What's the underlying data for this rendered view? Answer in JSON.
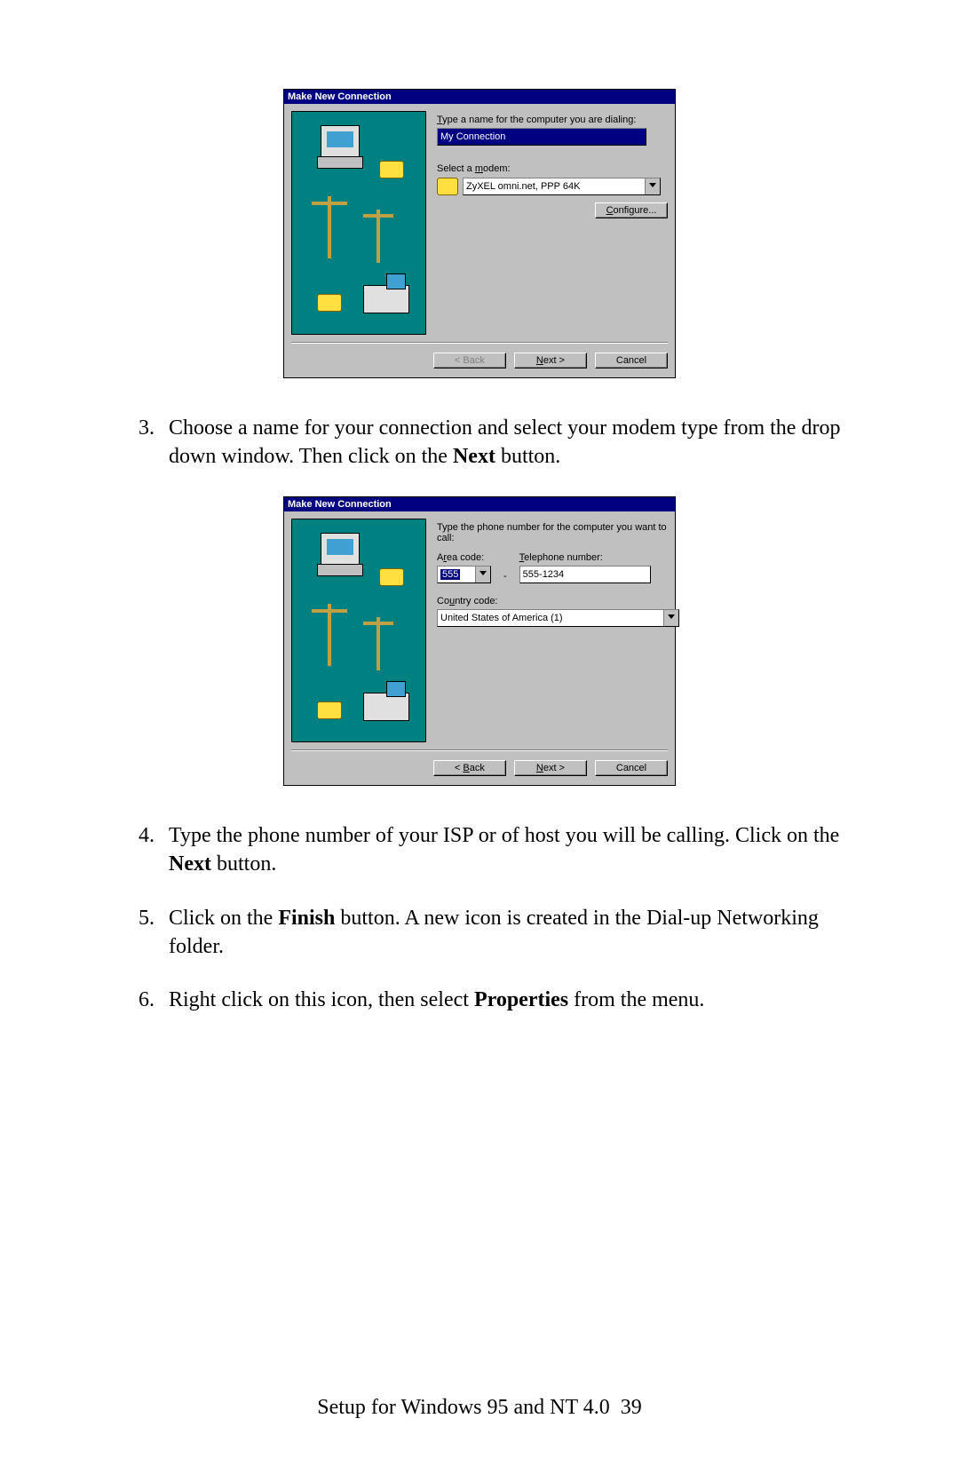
{
  "dialog1": {
    "title": "Make New Connection",
    "label1": "Type a name for the computer you are dialing:",
    "input_value": "My Connection",
    "label2": "Select a modem:",
    "modem_value": "ZyXEL omni.net, PPP  64K",
    "configure_btn": "Configure...",
    "back_btn": "< Back",
    "next_btn": "Next >",
    "cancel_btn": "Cancel"
  },
  "dialog2": {
    "title": "Make New Connection",
    "label1": "Type the phone number for the computer you want to call:",
    "area_label": "Area code:",
    "area_value": "555",
    "tel_label": "Telephone number:",
    "tel_value": "555-1234",
    "country_label": "Country code:",
    "country_value": "United States of America (1)",
    "back_btn": "< Back",
    "next_btn": "Next >",
    "cancel_btn": "Cancel"
  },
  "steps": {
    "s3a": "Choose a name for your connection and select your modem type from the drop down window. Then click on the ",
    "s3b": "Next",
    "s3c": " button.",
    "s4a": "Type the phone number of your ISP or of host you will be calling. Click on the ",
    "s4b": "Next",
    "s4c": " button.",
    "s5a": "Click on the ",
    "s5b": "Finish",
    "s5c": " button. A new icon is created in the Dial-up Networking folder.",
    "s6a": "Right click on this icon, then select ",
    "s6b": "Properties",
    "s6c": " from the menu."
  },
  "footer": {
    "text": "Setup for Windows 95 and NT 4.0",
    "page": "39"
  }
}
